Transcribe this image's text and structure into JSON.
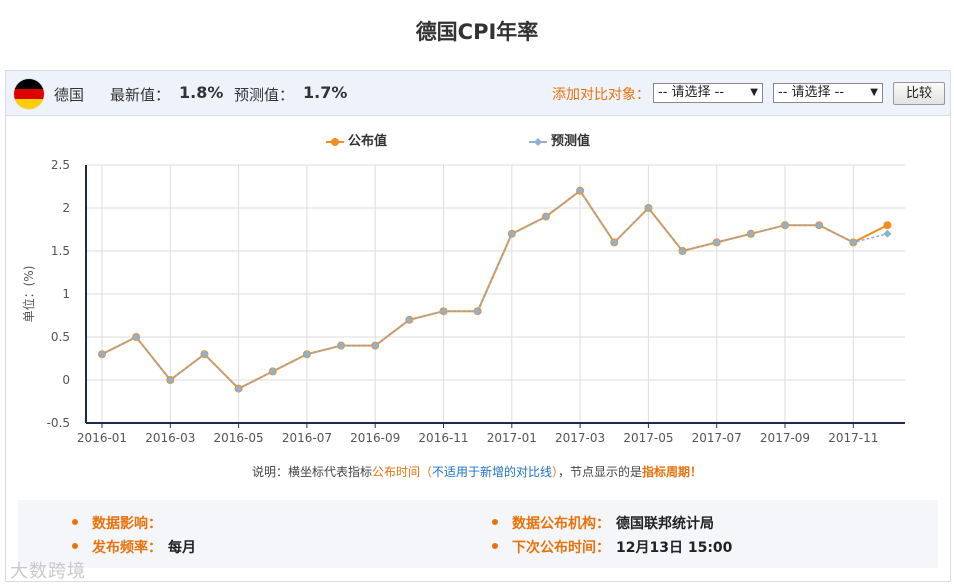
{
  "page": {
    "title": "德国CPI年率"
  },
  "header": {
    "country": "德国",
    "latest_label": "最新值：",
    "latest_value": "1.8%",
    "forecast_label": "预测值：",
    "forecast_value": "1.7%",
    "compare_label": "添加对比对象：",
    "select1_value": "-- 请选择 --",
    "select2_value": "-- 请选择 --",
    "compare_button": "比较",
    "flag_colors": [
      "#000000",
      "#dd0000",
      "#ffce00"
    ]
  },
  "legend": {
    "published": "公布值",
    "forecast": "预测值"
  },
  "note": {
    "part1": "说明：横坐标代表指标",
    "part2": "公布时间",
    "part3": "（",
    "part4": "不适用于新增的对比线",
    "part5": "）",
    "part6": "，节点显示的是",
    "part7": "指标周期",
    "part8": "！"
  },
  "info": {
    "impact_label": "数据影响：",
    "impact_value": "",
    "freq_label": "发布频率：",
    "freq_value": "每月",
    "agency_label": "数据公布机构：",
    "agency_value": "德国联邦统计局",
    "next_label": "下次公布时间：",
    "next_value": "12月13日 15:00"
  },
  "watermark": "大数跨境",
  "chart_data": {
    "type": "line",
    "ylabel": "单位：(%)",
    "ylim": [
      -0.5,
      2.5
    ],
    "yticks": [
      "-0.5",
      "0",
      "0.5",
      "1",
      "1.5",
      "2",
      "2.5"
    ],
    "xtick_labels": [
      "2016-01",
      "2016-03",
      "2016-05",
      "2016-07",
      "2016-09",
      "2016-11",
      "2017-01",
      "2017-03",
      "2017-05",
      "2017-07",
      "2017-09",
      "2017-11"
    ],
    "x": [
      "2016-01",
      "2016-02",
      "2016-03",
      "2016-04",
      "2016-05",
      "2016-06",
      "2016-07",
      "2016-08",
      "2016-09",
      "2016-10",
      "2016-11",
      "2016-12",
      "2017-01",
      "2017-02",
      "2017-03",
      "2017-04",
      "2017-05",
      "2017-06",
      "2017-07",
      "2017-08",
      "2017-09",
      "2017-10",
      "2017-11",
      "2017-12"
    ],
    "grid": true,
    "legend_position": "top-center",
    "series": [
      {
        "name": "公布值",
        "color": "#f28d21",
        "values": [
          0.3,
          0.5,
          0.0,
          0.3,
          -0.1,
          0.1,
          0.3,
          0.4,
          0.4,
          0.7,
          0.8,
          0.8,
          1.7,
          1.9,
          2.2,
          1.6,
          2.0,
          1.5,
          1.6,
          1.7,
          1.8,
          1.8,
          1.6,
          1.8
        ]
      },
      {
        "name": "预测值",
        "color": "#8fb0cf",
        "values": [
          0.3,
          0.5,
          0.0,
          0.3,
          -0.1,
          0.1,
          0.3,
          0.4,
          0.4,
          0.7,
          0.8,
          0.8,
          1.7,
          1.9,
          2.2,
          1.6,
          2.0,
          1.5,
          1.6,
          1.7,
          1.8,
          1.8,
          1.6,
          1.7
        ]
      }
    ]
  }
}
